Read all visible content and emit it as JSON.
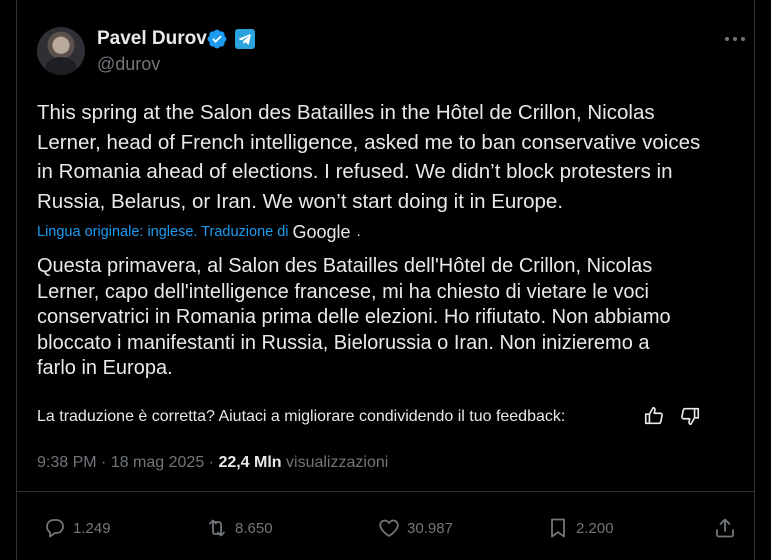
{
  "author": {
    "name": "Pavel Durov",
    "handle": "@durov"
  },
  "tweet": {
    "text": "This spring at the Salon des Batailles in the Hôtel de Crillon, Nicolas\nLerner, head of French intelligence, asked me to ban conservative voices\nin Romania ahead of elections. I refused. We didn’t block protesters in\nRussia, Belarus, or Iran. We won’t start doing it in Europe.",
    "translation_note": "Lingua originale: inglese. Traduzione di",
    "translation_provider": "Google",
    "translation_period": ".",
    "translated_text": "Questa primavera, al Salon des Batailles dell'Hôtel de Crillon, Nicolas\nLerner, capo dell'intelligence francese, mi ha chiesto di vietare le voci\nconservatrici in Romania prima delle elezioni. Ho rifiutato. Non abbiamo\nbloccato i manifestanti in Russia, Bielorussia o Iran. Non inizieremo a\nfarlo in Europa.",
    "feedback_question": "La traduzione è corretta? Aiutaci a migliorare condividendo il tuo feedback:"
  },
  "meta": {
    "time": "9:38 PM",
    "separator": " · ",
    "date": "18 mag 2025",
    "separator2": " · ",
    "views_count": "22,4 Mln",
    "views_label": " visualizzazioni"
  },
  "actions": {
    "replies": "1.249",
    "reposts": "8.650",
    "likes": "30.987",
    "bookmarks": "2.200"
  },
  "icons": {
    "verified": "verified-badge-icon",
    "telegram": "telegram-icon",
    "more": "more-icon",
    "reply": "reply-icon",
    "repost": "repost-icon",
    "like": "heart-icon",
    "bookmark": "bookmark-icon",
    "share": "share-icon"
  },
  "colors": {
    "background": "#000000",
    "text": "#e7e9ea",
    "secondary": "#71767b",
    "link": "#1d9bf0",
    "verified": "#1d9bf0",
    "telegram": "#2aa3df"
  }
}
